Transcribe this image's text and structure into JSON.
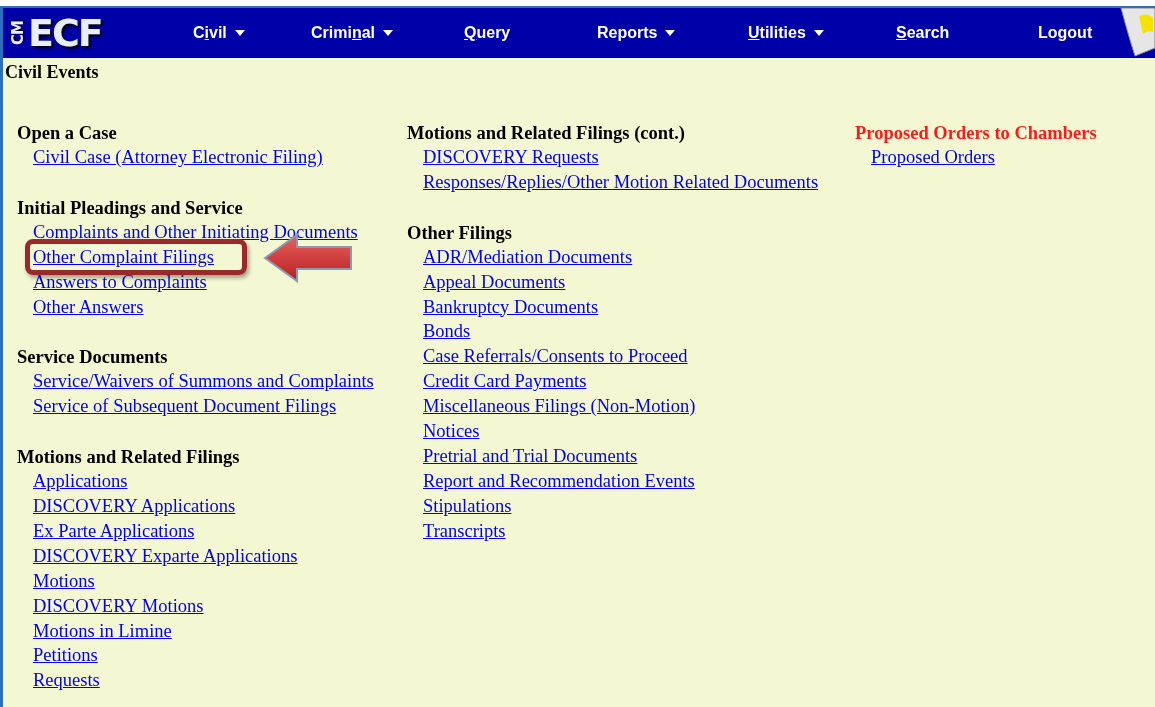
{
  "logo": {
    "small": "CM",
    "big": "ECF"
  },
  "menu": [
    {
      "before": "C",
      "key": "i",
      "after": "vil",
      "dropdown": true
    },
    {
      "before": "Crimi",
      "key": "n",
      "after": "al",
      "dropdown": true
    },
    {
      "key": "Q",
      "after": "uery",
      "dropdown": false
    },
    {
      "before": "Reports",
      "dropdown": true
    },
    {
      "key": "U",
      "after": "tilities",
      "dropdown": true
    },
    {
      "key": "S",
      "after": "earch",
      "dropdown": false
    },
    {
      "before": "Lo",
      "key": "g",
      "after": "out",
      "dropdown": false
    }
  ],
  "page_title": "Civil Events",
  "columns": [
    {
      "sections": [
        {
          "heading": "Open a Case",
          "alert": false,
          "links": [
            {
              "label": "Civil Case (Attorney Electronic Filing)",
              "highlighted": false
            }
          ]
        },
        {
          "heading": "Initial Pleadings and Service",
          "alert": false,
          "links": [
            {
              "label": "Complaints and Other Initiating Documents",
              "highlighted": false
            },
            {
              "label": "Other Complaint Filings",
              "highlighted": true
            },
            {
              "label": "Answers to Complaints",
              "highlighted": false
            },
            {
              "label": "Other Answers",
              "highlighted": false
            }
          ]
        },
        {
          "heading": "Service Documents",
          "alert": false,
          "links": [
            {
              "label": "Service/Waivers of Summons and Complaints",
              "highlighted": false
            },
            {
              "label": "Service of Subsequent Document Filings",
              "highlighted": false
            }
          ]
        },
        {
          "heading": "Motions and Related Filings",
          "alert": false,
          "links": [
            {
              "label": "Applications",
              "highlighted": false
            },
            {
              "label": "DISCOVERY Applications",
              "highlighted": false
            },
            {
              "label": "Ex Parte Applications",
              "highlighted": false
            },
            {
              "label": "DISCOVERY Exparte Applications",
              "highlighted": false
            },
            {
              "label": "Motions",
              "highlighted": false
            },
            {
              "label": "DISCOVERY Motions",
              "highlighted": false
            },
            {
              "label": "Motions in Limine",
              "highlighted": false
            },
            {
              "label": "Petitions",
              "highlighted": false
            },
            {
              "label": "Requests",
              "highlighted": false
            }
          ]
        }
      ]
    },
    {
      "sections": [
        {
          "heading": "Motions and Related Filings (cont.)",
          "alert": false,
          "links": [
            {
              "label": "DISCOVERY Requests",
              "highlighted": false
            },
            {
              "label": "Responses/Replies/Other Motion Related Documents",
              "highlighted": false
            }
          ]
        },
        {
          "heading": "Other Filings",
          "alert": false,
          "links": [
            {
              "label": "ADR/Mediation Documents",
              "highlighted": false
            },
            {
              "label": "Appeal Documents",
              "highlighted": false
            },
            {
              "label": "Bankruptcy Documents",
              "highlighted": false
            },
            {
              "label": "Bonds",
              "highlighted": false
            },
            {
              "label": "Case Referrals/Consents to Proceed",
              "highlighted": false
            },
            {
              "label": "Credit Card Payments",
              "highlighted": false
            },
            {
              "label": "Miscellaneous Filings (Non-Motion)",
              "highlighted": false
            },
            {
              "label": "Notices",
              "highlighted": false
            },
            {
              "label": "Pretrial and Trial Documents",
              "highlighted": false
            },
            {
              "label": "Report and Recommendation Events",
              "highlighted": false
            },
            {
              "label": "Stipulations",
              "highlighted": false
            },
            {
              "label": "Transcripts",
              "highlighted": false
            }
          ]
        }
      ]
    },
    {
      "sections": [
        {
          "heading": "Proposed Orders to Chambers",
          "alert": true,
          "links": [
            {
              "label": "Proposed Orders",
              "highlighted": false
            }
          ]
        }
      ]
    }
  ]
}
